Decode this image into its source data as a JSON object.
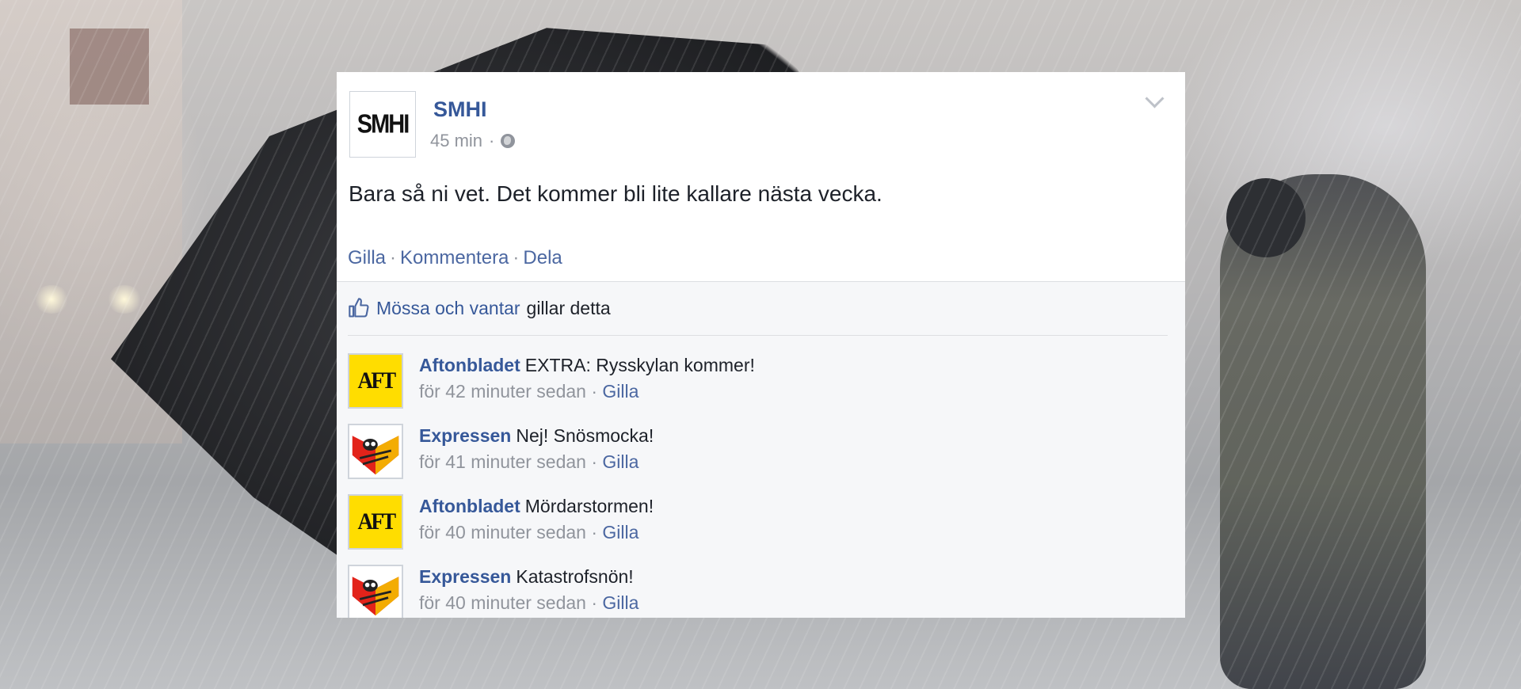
{
  "post": {
    "page_name": "SMHI",
    "avatar_text": "SMHI",
    "time": "45 min",
    "dot": "·",
    "text": "Bara så ni vet. Det kommer bli lite kallare nästa vecka."
  },
  "actions": {
    "like": "Gilla",
    "comment": "Kommentera",
    "share": "Dela",
    "sep": "·"
  },
  "likes": {
    "liker": "Mössa och vantar",
    "suffix": "gillar detta"
  },
  "comments": [
    {
      "author": "Aftonbladet",
      "avatar_text": "AFT",
      "text": "EXTRA: Rysskylan kommer!",
      "time": "för 42 minuter sedan",
      "like": "Gilla"
    },
    {
      "author": "Expressen",
      "avatar_text": "",
      "text": "Nej! Snösmocka!",
      "time": "för 41 minuter sedan",
      "like": "Gilla"
    },
    {
      "author": "Aftonbladet",
      "avatar_text": "AFT",
      "text": "Mördarstormen!",
      "time": "för 40 minuter sedan",
      "like": "Gilla"
    },
    {
      "author": "Expressen",
      "avatar_text": "",
      "text": "Katastrofsnön!",
      "time": "för 40 minuter sedan",
      "like": "Gilla"
    }
  ],
  "colors": {
    "link": "#365899",
    "meta": "#90949c",
    "aftonbladet_yellow": "#ffdd00",
    "expressen_red": "#e2231a"
  }
}
